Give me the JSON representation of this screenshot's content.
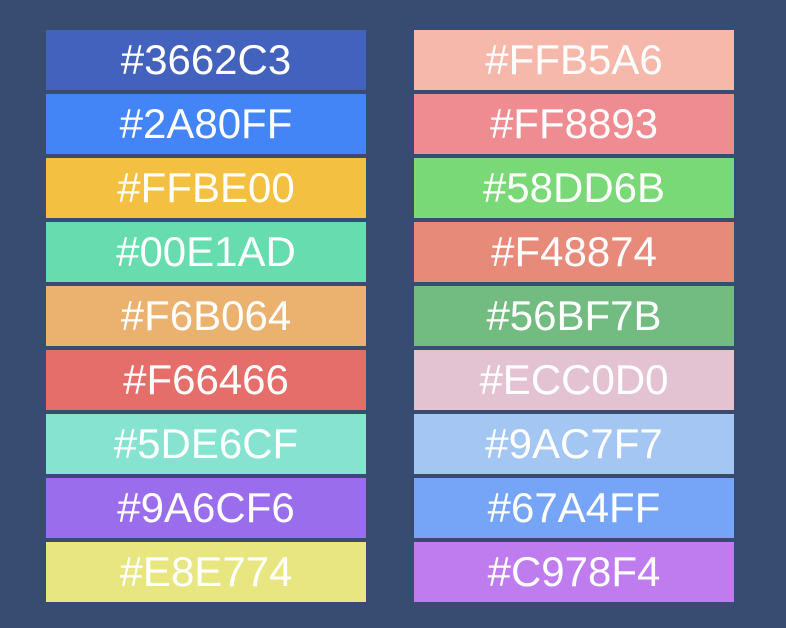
{
  "palette": {
    "left": [
      {
        "label": "#3662C3",
        "color": "#4262bd"
      },
      {
        "label": "#2A80FF",
        "color": "#4384f6"
      },
      {
        "label": "#FFBE00",
        "color": "#f3c042"
      },
      {
        "label": "#00E1AD",
        "color": "#66dcaf"
      },
      {
        "label": "#F6B064",
        "color": "#ebb26f"
      },
      {
        "label": "#F66466",
        "color": "#e56d6a"
      },
      {
        "label": "#5DE6CF",
        "color": "#86e3d0"
      },
      {
        "label": "#9A6CF6",
        "color": "#9a6ded"
      },
      {
        "label": "#E8E774",
        "color": "#e7e681"
      }
    ],
    "right": [
      {
        "label": "#FFB5A6",
        "color": "#f6b8aa"
      },
      {
        "label": "#FF8893",
        "color": "#ef8c92"
      },
      {
        "label": "#58DD6B",
        "color": "#7ad977"
      },
      {
        "label": "#F48874",
        "color": "#e88a79"
      },
      {
        "label": "#56BF7B",
        "color": "#72bb81"
      },
      {
        "label": "#ECC0D0",
        "color": "#e3c3d1"
      },
      {
        "label": "#9AC7F7",
        "color": "#a3c6f2"
      },
      {
        "label": "#67A4FF",
        "color": "#76a5f7"
      },
      {
        "label": "#C978F4",
        "color": "#bf7cef"
      }
    ]
  }
}
